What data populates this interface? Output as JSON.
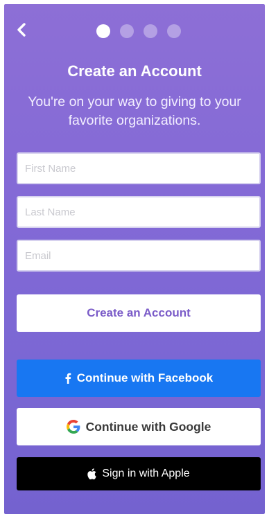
{
  "header": {
    "back_icon": "chevron-left-icon",
    "progress": {
      "total_steps": 4,
      "current_step": 1
    }
  },
  "title": "Create an Account",
  "subtitle": "You're on your way to giving to your favorite organizations.",
  "form": {
    "first_name": {
      "placeholder": "First Name",
      "value": ""
    },
    "last_name": {
      "placeholder": "Last Name",
      "value": ""
    },
    "email": {
      "placeholder": "Email",
      "value": ""
    }
  },
  "buttons": {
    "create_account": "Create an Account",
    "facebook": "Continue with Facebook",
    "google": "Continue with Google",
    "apple": "Sign in with Apple"
  },
  "colors": {
    "background_top": "#8d6fd6",
    "background_bottom": "#7462cf",
    "accent_text": "#7a5bc8",
    "facebook_blue": "#1877f2",
    "apple_black": "#000000"
  }
}
